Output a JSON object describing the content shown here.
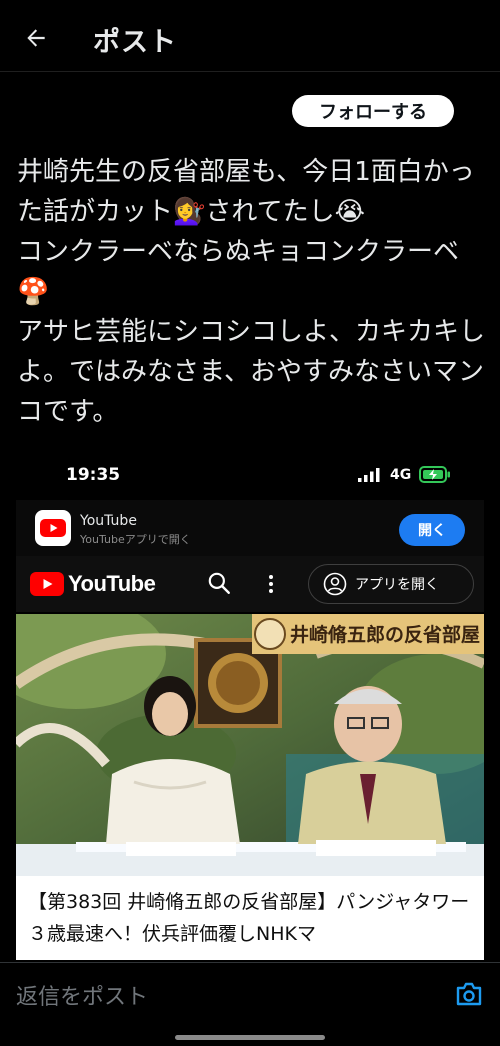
{
  "header": {
    "title": "ポスト"
  },
  "follow_button": {
    "label": "フォローする"
  },
  "post": {
    "text": "井崎先生の反省部屋も、今日1面白かった話がカット💇‍♀️されてたし😭\nコンクラーベならぬキョコンクラーベ🍄\nアサヒ芸能にシコシコしよ、カキカキしよ。ではみなさま、おやすみなさいマンコです。"
  },
  "embedded_screenshot": {
    "status_time": "19:35",
    "network": "4G",
    "banner": {
      "app_name": "YouTube",
      "subtitle": "YouTubeアプリで開く",
      "open_button": "開く"
    },
    "youtube_bar": {
      "logo_text": "YouTube",
      "open_app_button": "アプリを開く"
    },
    "video": {
      "thumbnail_caption": "井崎脩五郎の反省部屋",
      "title": "【第383回 井崎脩五郎の反省部屋】パンジャタワー ３歳最速へ！伏兵評価覆しNHKマ"
    }
  },
  "reply": {
    "placeholder": "返信をポスト"
  },
  "colors": {
    "follow_bg": "#ffffff",
    "open_btn": "#1d7cf2",
    "yt_red": "#ff0000",
    "reply_camera": "#1d9bf0"
  },
  "icons": [
    "back-arrow-icon",
    "signal-icon",
    "battery-icon",
    "youtube-app-icon",
    "youtube-logo-icon",
    "search-icon",
    "more-vert-icon",
    "account-icon",
    "camera-icon"
  ]
}
